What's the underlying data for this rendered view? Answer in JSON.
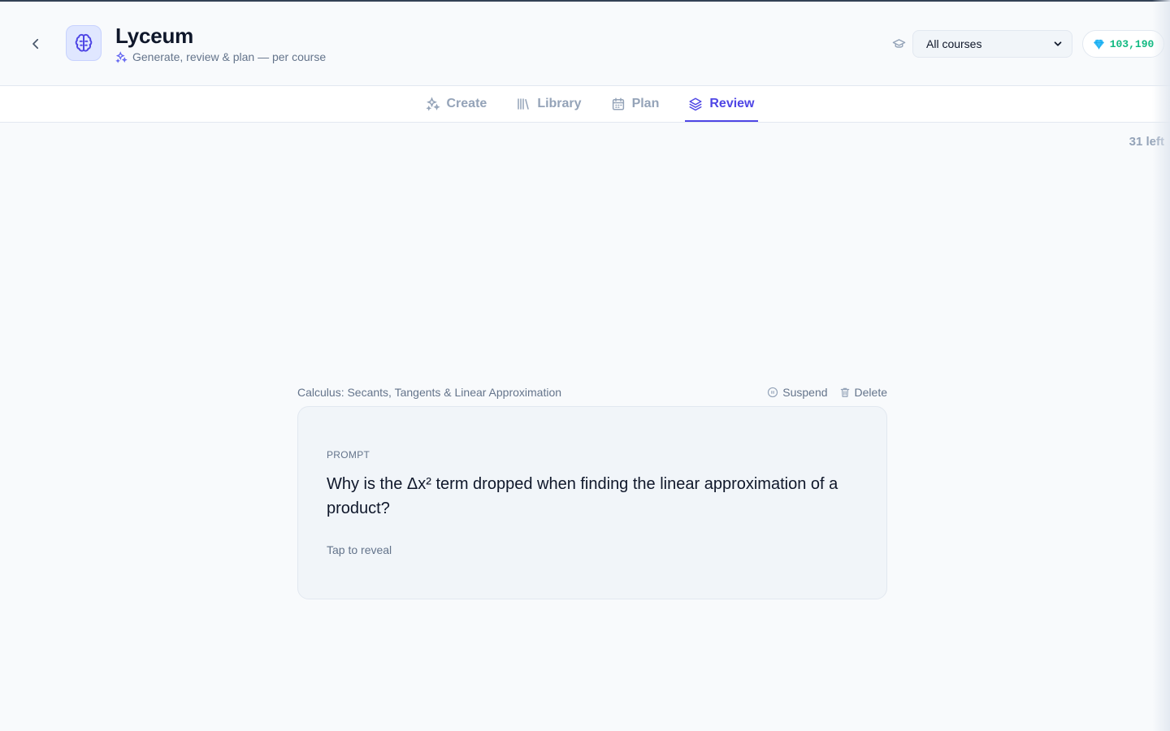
{
  "app": {
    "title": "Lyceum",
    "subtitle": "Generate, review & plan — per course"
  },
  "header": {
    "course_select_value": "All courses",
    "gems": "103,190",
    "icons": {
      "back": "chevron-left-icon",
      "logo": "brain-icon",
      "course": "graduation-cap-icon",
      "gem": "diamond-icon"
    }
  },
  "tabs": [
    {
      "label": "Create",
      "icon": "sparkles-icon",
      "active": false
    },
    {
      "label": "Library",
      "icon": "library-icon",
      "active": false
    },
    {
      "label": "Plan",
      "icon": "calendar-icon",
      "active": false
    },
    {
      "label": "Review",
      "icon": "layers-icon",
      "active": true
    }
  ],
  "review": {
    "remaining": "31 left",
    "deck": "Calculus: Secants, Tangents & Linear Approximation",
    "suspend_label": "Suspend",
    "delete_label": "Delete",
    "card_label": "PROMPT",
    "prompt": "Why is the Δx² term dropped when finding the linear approximation of a product?",
    "hint": "Tap to reveal"
  },
  "colors": {
    "accent": "#4f46e5",
    "gem": "#10b981",
    "muted": "#94a3b8"
  }
}
